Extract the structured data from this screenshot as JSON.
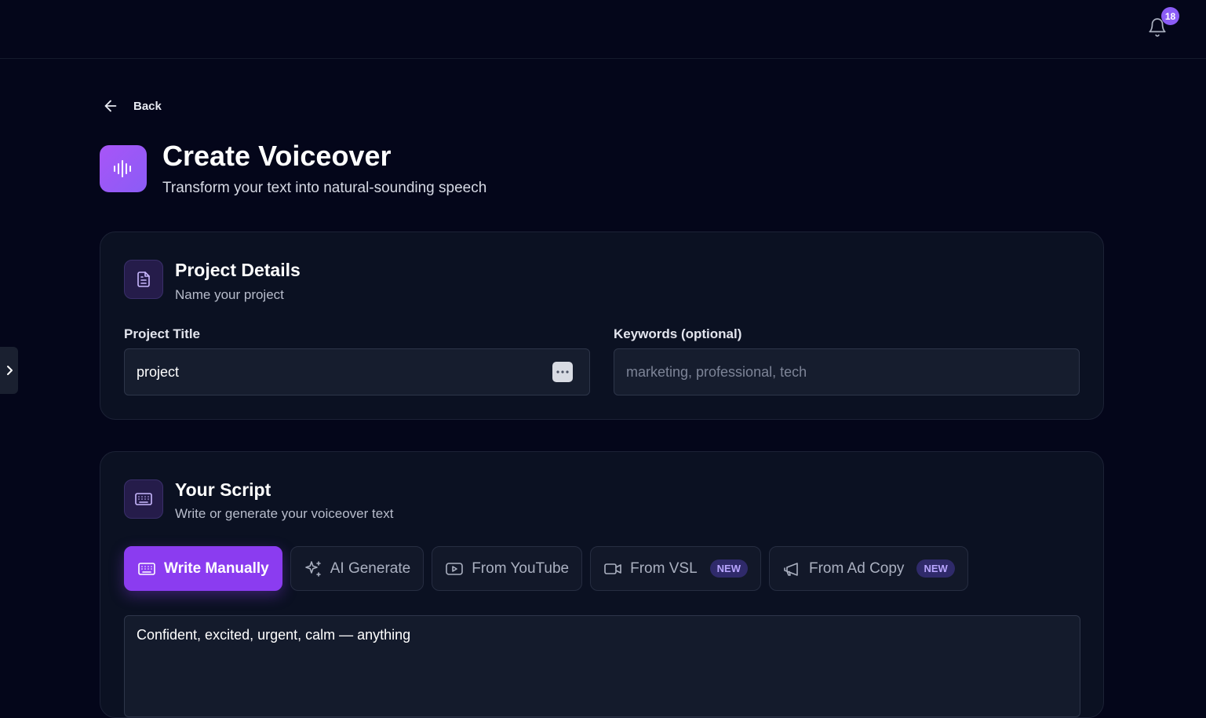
{
  "topbar": {
    "notification_count": "18",
    "bell_icon": "bell-icon"
  },
  "nav": {
    "back_label": "Back",
    "sidebar_toggle_icon": "chevron-right-icon"
  },
  "header": {
    "title": "Create Voiceover",
    "subtitle": "Transform your text into natural-sounding speech",
    "icon": "audio-waveform-icon",
    "accent": "#8b5cf6"
  },
  "project_details": {
    "title": "Project Details",
    "subtitle": "Name your project",
    "icon": "document-icon",
    "project_title_label": "Project Title",
    "project_title_value": "project",
    "keywords_label": "Keywords (optional)",
    "keywords_placeholder": "marketing, professional, tech"
  },
  "script": {
    "title": "Your Script",
    "subtitle": "Write or generate your voiceover text",
    "icon": "keyboard-icon",
    "tabs": [
      {
        "label": "Write Manually",
        "icon": "keyboard-icon",
        "active": true
      },
      {
        "label": "AI Generate",
        "icon": "sparkles-icon",
        "active": false
      },
      {
        "label": "From YouTube",
        "icon": "youtube-play-icon",
        "active": false
      },
      {
        "label": "From VSL",
        "icon": "video-camera-icon",
        "active": false,
        "badge": "NEW"
      },
      {
        "label": "From Ad Copy",
        "icon": "megaphone-icon",
        "active": false,
        "badge": "NEW"
      }
    ],
    "text": "Confident, excited, urgent, calm — anything"
  }
}
